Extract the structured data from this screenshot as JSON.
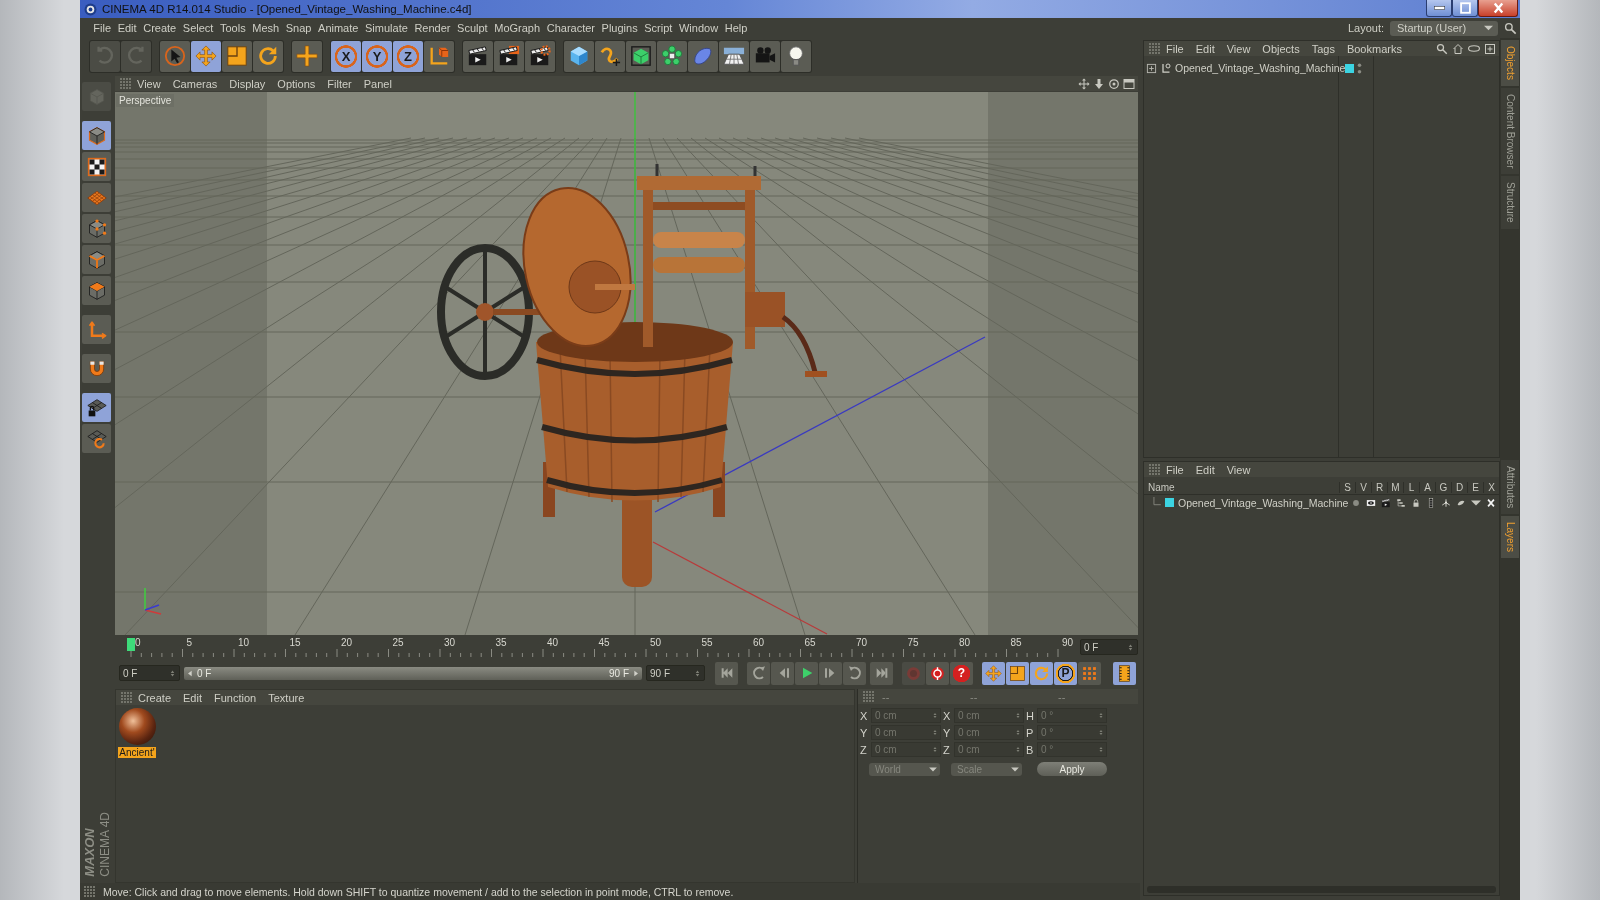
{
  "window": {
    "title": "CINEMA 4D R14.014 Studio - [Opened_Vintage_Washing_Machine.c4d]"
  },
  "menu_bar": [
    "File",
    "Edit",
    "Create",
    "Select",
    "Tools",
    "Mesh",
    "Snap",
    "Animate",
    "Simulate",
    "Render",
    "Sculpt",
    "MoGraph",
    "Character",
    "Plugins",
    "Script",
    "Window",
    "Help"
  ],
  "layout": {
    "label": "Layout:",
    "value": "Startup (User)"
  },
  "toolbar": {
    "history": [
      {
        "disabled": true
      },
      {
        "disabled": true
      }
    ],
    "tools": [
      {
        "selected": false
      },
      {
        "selected": true
      },
      {
        "selected": false
      },
      {
        "selected": false
      },
      {
        "selected": false
      }
    ],
    "axes": [
      {
        "label": "X",
        "selected": true
      },
      {
        "label": "Y",
        "selected": true
      },
      {
        "label": "Z",
        "selected": true
      }
    ]
  },
  "left_toolbar": {
    "make_editable": {
      "disabled": true
    },
    "modes": [
      {
        "selected": true
      },
      {
        "selected": false
      },
      {
        "selected": false
      },
      {
        "selected": false
      },
      {
        "selected": false
      },
      {
        "selected": false
      }
    ],
    "toggles": [
      {
        "selected": false
      },
      {
        "selected": false
      },
      {
        "selected": true
      },
      {
        "selected": false
      }
    ]
  },
  "viewport": {
    "menu": [
      "View",
      "Cameras",
      "Display",
      "Options",
      "Filter",
      "Panel"
    ],
    "camera": "Perspective"
  },
  "timeline": {
    "ticks": [
      "0",
      "5",
      "10",
      "15",
      "20",
      "25",
      "30",
      "35",
      "40",
      "45",
      "50",
      "55",
      "60",
      "65",
      "70",
      "75",
      "80",
      "85",
      "90"
    ],
    "playhead": {
      "level": 0
    },
    "current_frame": "0 F",
    "start_frame": "0 F",
    "range_start": "0 F",
    "range_end": "90 F",
    "end_frame": "90 F"
  },
  "record_tools": [
    {
      "disabled": true
    },
    {
      "disabled": false
    },
    {
      "label": "?",
      "disabled": false
    }
  ],
  "key_tools": [
    {
      "selected": true
    },
    {
      "selected": true
    },
    {
      "selected": true
    },
    {
      "label": "P",
      "selected": true
    },
    {
      "selected": false
    }
  ],
  "timeline_view": {
    "selected": true
  },
  "material_manager": {
    "menu": [
      "Create",
      "Edit",
      "Function",
      "Texture"
    ],
    "materials": [
      {
        "name": "Ancient'",
        "selected": true
      }
    ]
  },
  "coordinates": {
    "headers": [
      "--",
      "--",
      "--"
    ],
    "columns": [
      [
        {
          "axis": "X",
          "value": "0 cm"
        },
        {
          "axis": "Y",
          "value": "0 cm"
        },
        {
          "axis": "Z",
          "value": "0 cm"
        }
      ],
      [
        {
          "axis": "X",
          "value": "0 cm"
        },
        {
          "axis": "Y",
          "value": "0 cm"
        },
        {
          "axis": "Z",
          "value": "0 cm"
        }
      ],
      [
        {
          "axis": "H",
          "value": "0 °"
        },
        {
          "axis": "P",
          "value": "0 °"
        },
        {
          "axis": "B",
          "value": "0 °"
        }
      ]
    ],
    "dropdowns": [
      "World",
      "Scale"
    ],
    "apply": "Apply"
  },
  "objects_panel": {
    "menu": [
      "File",
      "Edit",
      "View",
      "Objects",
      "Tags",
      "Bookmarks"
    ],
    "objects": [
      {
        "name": "Opened_Vintage_Washing_Machine",
        "expanded": false,
        "color": "#3cd4e2"
      }
    ]
  },
  "layers_panel": {
    "menu": [
      "File",
      "Edit",
      "View"
    ],
    "columns": [
      "Name",
      "S",
      "V",
      "R",
      "M",
      "L",
      "A",
      "G",
      "D",
      "E",
      "X"
    ],
    "layers": [
      {
        "name": "Opened_Vintage_Washing_Machine",
        "color": "#3cd4e2"
      }
    ]
  },
  "side_tabs": {
    "top": [
      {
        "label": "Objects",
        "selected": true
      },
      {
        "label": "Content Browser",
        "selected": false
      },
      {
        "label": "Structure",
        "selected": false
      }
    ],
    "bottom": [
      {
        "label": "Attributes",
        "selected": false
      },
      {
        "label": "Layers",
        "selected": true
      }
    ]
  },
  "status_bar": "Move: Click and drag to move elements. Hold down SHIFT to quantize movement / add to the selection in point mode, CTRL to remove.",
  "logo": {
    "brand": "MAXON",
    "product": "CINEMA 4D"
  }
}
